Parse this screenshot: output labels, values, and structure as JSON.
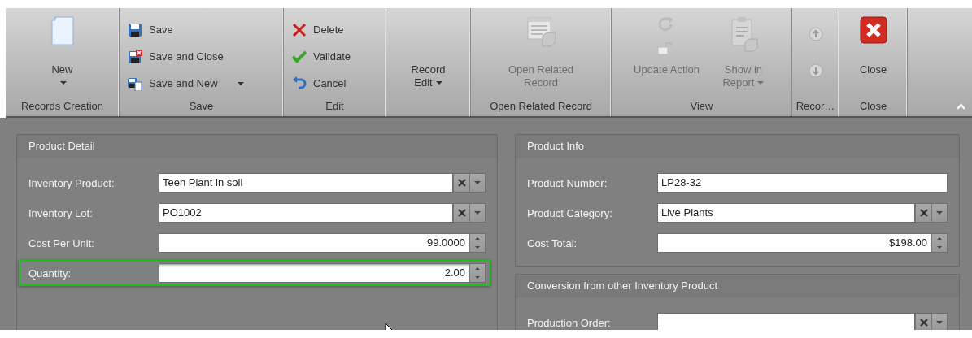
{
  "ribbon": {
    "groups": [
      {
        "label": "Records Creation",
        "items": [
          {
            "kind": "large",
            "label": "New",
            "dropdown": true,
            "disabled": false
          }
        ]
      },
      {
        "label": "Save",
        "items": [
          {
            "kind": "small",
            "label": "Save",
            "dropdown": false,
            "disabled": false
          },
          {
            "kind": "small",
            "label": "Save and Close",
            "dropdown": false,
            "disabled": false
          },
          {
            "kind": "small",
            "label": "Save and New",
            "dropdown": true,
            "disabled": false
          }
        ]
      },
      {
        "label": "Edit",
        "items": [
          {
            "kind": "small",
            "label": "Delete",
            "dropdown": false,
            "disabled": false
          },
          {
            "kind": "small",
            "label": "Validate",
            "dropdown": false,
            "disabled": false
          },
          {
            "kind": "small",
            "label": "Cancel",
            "dropdown": false,
            "disabled": false
          }
        ]
      },
      {
        "items": [
          {
            "kind": "large",
            "label": "Record Edit",
            "dropdown": true,
            "disabled": false
          }
        ]
      },
      {
        "label": "Open Related Record",
        "items": [
          {
            "kind": "large",
            "label": "Open Related Record",
            "dropdown": false,
            "disabled": true
          }
        ]
      },
      {
        "label": "View",
        "items": [
          {
            "kind": "large",
            "label": "Update Action",
            "dropdown": false,
            "disabled": true
          },
          {
            "kind": "large",
            "label": "Show in Report",
            "dropdown": true,
            "disabled": true
          }
        ]
      },
      {
        "label": "Recor…",
        "items": [
          {
            "kind": "icon",
            "disabled": true
          },
          {
            "kind": "icon",
            "disabled": true
          }
        ]
      },
      {
        "label": "Close",
        "items": [
          {
            "kind": "large",
            "label": "Close",
            "dropdown": false,
            "disabled": false
          }
        ]
      }
    ]
  },
  "left_panels": [
    {
      "title": "Product Detail",
      "fields": [
        {
          "label": "Inventory Product:",
          "value": "Teen Plant in soil",
          "kind": "lookup",
          "focused": false
        },
        {
          "label": "Inventory Lot:",
          "value": "PO1002",
          "kind": "lookup",
          "focused": false
        },
        {
          "label": "Cost Per Unit:",
          "value": "99.0000",
          "kind": "spin",
          "focused": false
        },
        {
          "label": "Quantity:",
          "value": "2.00",
          "kind": "spin",
          "focused": true
        }
      ]
    }
  ],
  "right_panels": [
    {
      "title": "Product Info",
      "fields": [
        {
          "label": "Product Number:",
          "value": "LP28-32",
          "kind": "text",
          "focused": false
        },
        {
          "label": "Product Category:",
          "value": "Live Plants",
          "kind": "lookup",
          "focused": false
        },
        {
          "label": "Cost Total:",
          "value": "$198.00",
          "kind": "spin",
          "focused": false
        }
      ]
    },
    {
      "title": "Conversion from other Inventory Product",
      "fields": [
        {
          "label": "Production Order:",
          "kind": "lookup",
          "focused": false
        }
      ]
    }
  ]
}
